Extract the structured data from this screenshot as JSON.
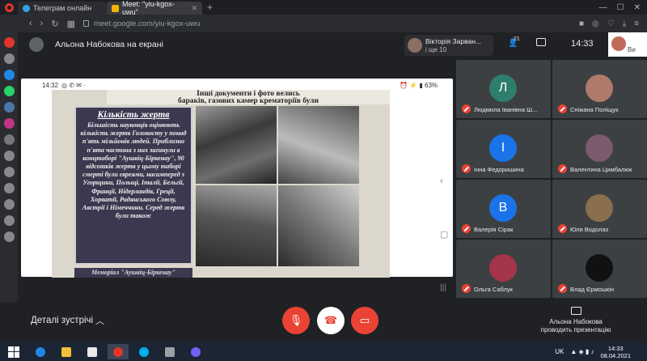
{
  "browser": {
    "tabs": [
      {
        "label": "Телеграм онлайн",
        "active": false
      },
      {
        "label": "Meet: \"yiu-kgox-uwu\"",
        "active": true
      }
    ],
    "url": "meet.google.com/yiu-kgox-uwu"
  },
  "meet": {
    "presenting_label": "Альона Набокова на екрані",
    "speaker_chip": {
      "name": "Вікторія Зарван...",
      "sub": "і ще 10"
    },
    "people_count": "21",
    "time": "14:33",
    "self_label": "Ви"
  },
  "phone_status": {
    "time": "14:32",
    "battery": "63%"
  },
  "slide": {
    "header_text": "Інші документи і фото велись\nбараків, газових камер крематоріїв були",
    "box_title": "Кількість жертв",
    "box_body": "Більшість науковців оцінюють кількість жертв Голокосту у понад п'ять мільйонів людей. Приблизно п'ята частина з них загинули в концтаборі \"Аушвіц-Біркенау\", 90 відсотків жертв у цьому таборі смерті були євреями, насамперед з Угорщини, Польщі, Італії, Бельгії, Франції, Нідерландів, Греції, Хорватії, Радянського Союзу, Австрії і Німеччини. Серед жертв були також",
    "bottom_text": "Меморіал \"Аушвіц-Біркенау\""
  },
  "participants": [
    {
      "name": "Людмила Іванівна Ш...",
      "initial": "Л",
      "color": "#2f7d6d"
    },
    {
      "name": "Сніжана Поліщук",
      "initial": "",
      "color": "#b07a6a"
    },
    {
      "name": "Інна Федоришина",
      "initial": "І",
      "color": "#1a73e8"
    },
    {
      "name": "Валентина Цимбалюк",
      "initial": "",
      "color": "#7a5a6e"
    },
    {
      "name": "Валерія Сірак",
      "initial": "В",
      "color": "#1a73e8"
    },
    {
      "name": "Юля Водолаз",
      "initial": "",
      "color": "#8a6f4e"
    },
    {
      "name": "Ольга Саблук",
      "initial": "",
      "color": "#a3344a"
    },
    {
      "name": "Влад Єрмошкін",
      "initial": "",
      "color": "#111111"
    }
  ],
  "bottom": {
    "details": "Деталі зустрічі",
    "present": "Альона Набокова проводить презентацію"
  },
  "taskbar": {
    "lang": "UK",
    "time": "14:33",
    "date": "08.04.2021"
  }
}
